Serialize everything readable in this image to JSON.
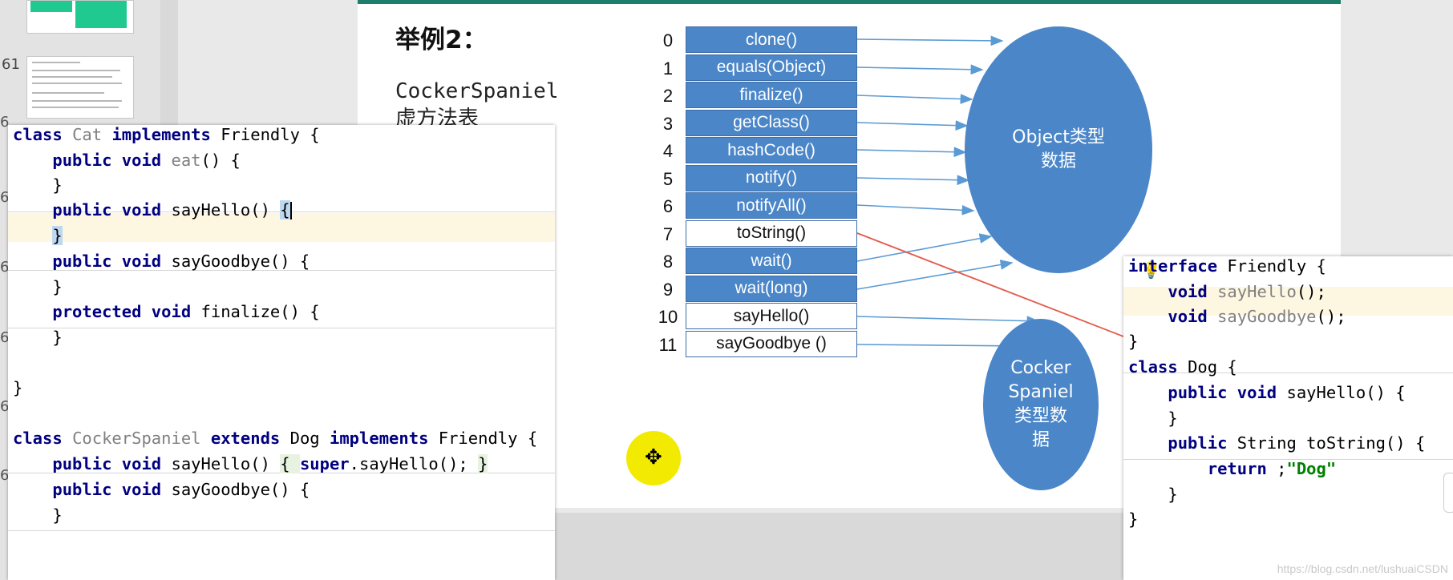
{
  "slides_panel": {
    "thumbnail_numbers": [
      "61",
      "6",
      "6",
      "6",
      "6",
      "6",
      "6"
    ]
  },
  "slide": {
    "title": "举例2：",
    "vtable_label": "CockerSpaniel\n虚方法表",
    "vtable": [
      {
        "index": "0",
        "method": "clone()",
        "highlight": "blue"
      },
      {
        "index": "1",
        "method": "equals(Object)",
        "highlight": "blue"
      },
      {
        "index": "2",
        "method": "finalize()",
        "highlight": "blue"
      },
      {
        "index": "3",
        "method": "getClass()",
        "highlight": "blue"
      },
      {
        "index": "4",
        "method": "hashCode()",
        "highlight": "blue"
      },
      {
        "index": "5",
        "method": "notify()",
        "highlight": "blue"
      },
      {
        "index": "6",
        "method": "notifyAll()",
        "highlight": "blue"
      },
      {
        "index": "7",
        "method": "toString()",
        "highlight": "white"
      },
      {
        "index": "8",
        "method": "wait()",
        "highlight": "blue"
      },
      {
        "index": "9",
        "method": "wait(long)",
        "highlight": "blue"
      },
      {
        "index": "10",
        "method": "sayHello()",
        "highlight": "white"
      },
      {
        "index": "11",
        "method": "sayGoodbye ()",
        "highlight": "white"
      }
    ],
    "object_ellipse": "Object类型\n数据",
    "cocker_ellipse": "Cocker\nSpaniel\n类型数\n据"
  },
  "cat_editor": {
    "lines": [
      {
        "kw1": "class ",
        "dim1": "Cat ",
        "kw2": "implements ",
        "rest": "Friendly {"
      },
      {
        "indent": "    ",
        "kw1": "public void ",
        "dim1": "eat",
        "rest": "() {"
      },
      {
        "indent": "    ",
        "rest": "}"
      },
      {
        "indent": "    ",
        "kw1": "public void ",
        "rest": "sayHello() ",
        "brace": "{"
      },
      {
        "indent": "    ",
        "brace": "}"
      },
      {
        "indent": "    ",
        "kw1": "public void ",
        "rest": "sayGoodbye() {"
      },
      {
        "indent": "    ",
        "rest": "}"
      },
      {
        "indent": "    ",
        "kw1": "protected void ",
        "rest": "finalize() {"
      },
      {
        "indent": "    ",
        "rest": "}"
      },
      {
        "rest": ""
      },
      {
        "rest": "}"
      },
      {
        "rest": ""
      },
      {
        "kw1": "class ",
        "dim1": "CockerSpaniel ",
        "kw2": "extends ",
        "rest": "Dog ",
        "kw3": "implements ",
        "rest2": "Friendly {"
      },
      {
        "indent": "    ",
        "kw1": "public void ",
        "rest": "sayHello() ",
        "brace": "{ ",
        "kw2": "super",
        "rest2": ".sayHello(); ",
        "brace2": "}"
      },
      {
        "indent": "    ",
        "kw1": "public void ",
        "rest": "sayGoodbye() {"
      },
      {
        "indent": "    ",
        "rest": "}"
      }
    ]
  },
  "dog_editor": {
    "lines": [
      {
        "kw1": "interface ",
        "rest": "Friendly {"
      },
      {
        "indent": "    ",
        "kw1": "void ",
        "dim1": "sayHello",
        "rest": "();"
      },
      {
        "indent": "    ",
        "kw1": "void ",
        "dim1": "sayGoodbye",
        "rest": "();"
      },
      {
        "rest": "}"
      },
      {
        "kw1": "class ",
        "rest": "Dog {"
      },
      {
        "indent": "    ",
        "kw1": "public void ",
        "rest": "sayHello() {"
      },
      {
        "indent": "    ",
        "rest": "}"
      },
      {
        "indent": "    ",
        "kw1": "public ",
        "rest": "String toString() {"
      },
      {
        "indent": "        ",
        "kw1": "return ",
        "str": "\"Dog\"",
        "rest": ";"
      },
      {
        "indent": "    ",
        "rest": "}"
      },
      {
        "rest": "}"
      }
    ]
  },
  "watermark": "https://blog.csdn.net/lushuaiCSDN",
  "colors": {
    "cell_blue": "#4a86c8",
    "arrow": "#5b9bd5",
    "red_line": "#e35a4a",
    "keyword": "#000080",
    "string": "#008000"
  }
}
